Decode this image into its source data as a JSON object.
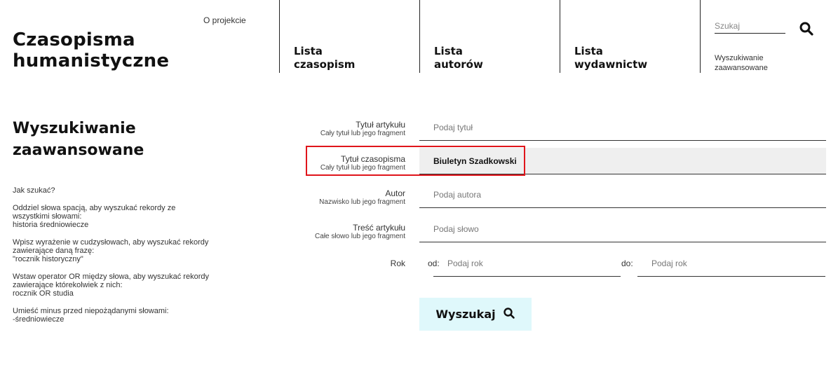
{
  "header": {
    "about_link": "O projekcie",
    "site_title_line1": "Czasopisma",
    "site_title_line2": "humanistyczne",
    "nav": [
      {
        "line1": "Lista",
        "line2": "czasopism"
      },
      {
        "line1": "Lista",
        "line2": "autorów"
      },
      {
        "line1": "Lista",
        "line2": "wydawnictw"
      }
    ],
    "quick_search_placeholder": "Szukaj",
    "advanced_link_line1": "Wyszukiwanie",
    "advanced_link_line2": "zaawansowane"
  },
  "page": {
    "title_line1": "Wyszukiwanie",
    "title_line2": "zaawansowane"
  },
  "help": {
    "heading": "Jak szukać?",
    "blocks": [
      {
        "lines": [
          "Oddziel słowa spacją, aby wyszukać rekordy ze",
          "wszystkimi słowami:",
          "historia średniowiecze"
        ]
      },
      {
        "lines": [
          "Wpisz wyrażenie w cudzysłowach, aby wyszukać rekordy",
          "zawierające daną frazę:",
          "\"rocznik historyczny\""
        ]
      },
      {
        "lines": [
          "Wstaw operator OR między słowa, aby wyszukać rekordy",
          "zawierające którekolwiek z nich:",
          "rocznik OR studia"
        ]
      },
      {
        "lines": [
          "Umieść minus przed niepożądanymi słowami:",
          "-średniowiecze"
        ]
      }
    ]
  },
  "form": {
    "fields": [
      {
        "label": "Tytuł artykułu",
        "sublabel": "Cały tytuł lub jego fragment",
        "value": "",
        "placeholder": "Podaj tytuł"
      },
      {
        "label": "Tytuł czasopisma",
        "sublabel": "Cały tytuł lub jego fragment",
        "value": "Biuletyn Szadkowski",
        "placeholder": ""
      },
      {
        "label": "Autor",
        "sublabel": "Nazwisko lub jego fragment",
        "value": "",
        "placeholder": "Podaj autora"
      },
      {
        "label": "Treść artykułu",
        "sublabel": "Całe słowo lub jego fragment",
        "value": "",
        "placeholder": "Podaj słowo"
      }
    ],
    "year": {
      "label": "Rok",
      "from_label": "od:",
      "from_placeholder": "Podaj rok",
      "to_label": "do:",
      "to_placeholder": "Podaj rok"
    },
    "submit_label": "Wyszukaj"
  },
  "colors": {
    "highlight": "#e0151b",
    "submit_bg": "#dff8fb",
    "filled_bg": "#efefef"
  },
  "icons": {
    "quick_search": "search-icon",
    "submit": "search-icon"
  }
}
